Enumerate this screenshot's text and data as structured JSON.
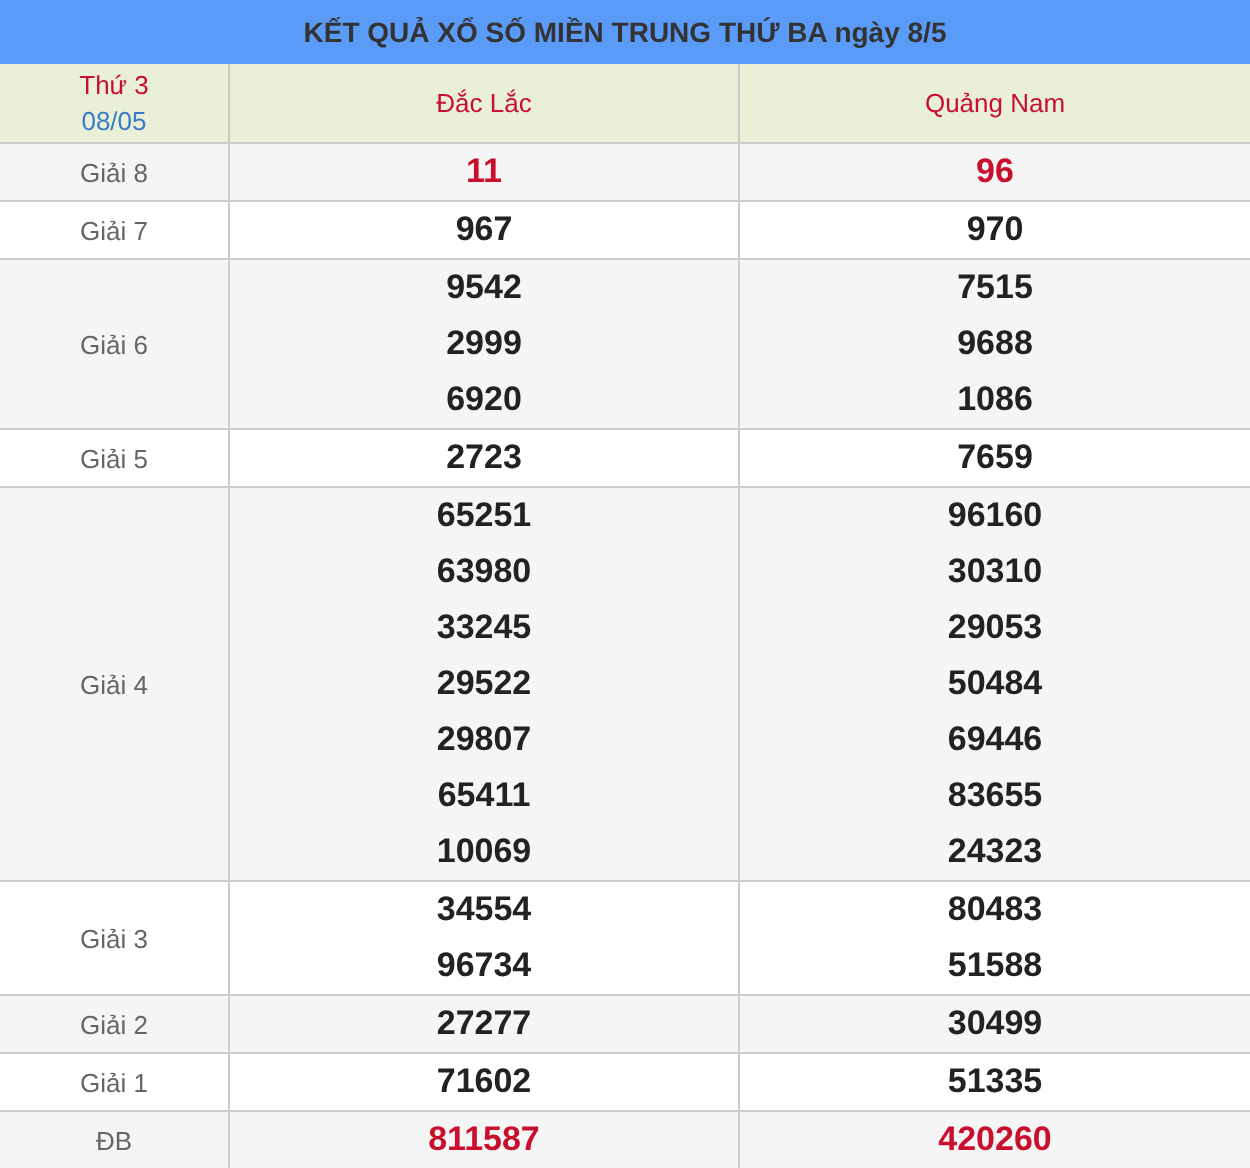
{
  "title": "KẾT QUẢ XỔ SỐ MIỀN TRUNG THỨ BA ngày 8/5",
  "header": {
    "weekday": "Thứ 3",
    "date": "08/05",
    "provinces": [
      "Đắc Lắc",
      "Quảng Nam"
    ]
  },
  "prizes": [
    {
      "label": "Giải 8",
      "highlight": true,
      "results": [
        [
          "11"
        ],
        [
          "96"
        ]
      ]
    },
    {
      "label": "Giải 7",
      "highlight": false,
      "results": [
        [
          "967"
        ],
        [
          "970"
        ]
      ]
    },
    {
      "label": "Giải 6",
      "highlight": false,
      "results": [
        [
          "9542",
          "2999",
          "6920"
        ],
        [
          "7515",
          "9688",
          "1086"
        ]
      ]
    },
    {
      "label": "Giải 5",
      "highlight": false,
      "results": [
        [
          "2723"
        ],
        [
          "7659"
        ]
      ]
    },
    {
      "label": "Giải 4",
      "highlight": false,
      "results": [
        [
          "65251",
          "63980",
          "33245",
          "29522",
          "29807",
          "65411",
          "10069"
        ],
        [
          "96160",
          "30310",
          "29053",
          "50484",
          "69446",
          "83655",
          "24323"
        ]
      ]
    },
    {
      "label": "Giải 3",
      "highlight": false,
      "results": [
        [
          "34554",
          "96734"
        ],
        [
          "80483",
          "51588"
        ]
      ]
    },
    {
      "label": "Giải 2",
      "highlight": false,
      "results": [
        [
          "27277"
        ],
        [
          "30499"
        ]
      ]
    },
    {
      "label": "Giải 1",
      "highlight": false,
      "results": [
        [
          "71602"
        ],
        [
          "51335"
        ]
      ]
    },
    {
      "label": "ĐB",
      "highlight": true,
      "results": [
        [
          "811587"
        ],
        [
          "420260"
        ]
      ]
    }
  ]
}
